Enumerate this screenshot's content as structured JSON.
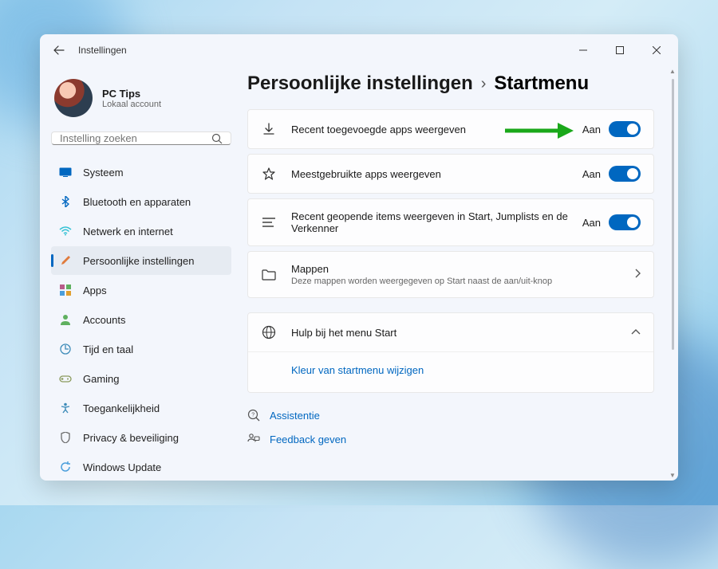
{
  "window": {
    "title": "Instellingen"
  },
  "profile": {
    "name": "PC Tips",
    "account_type": "Lokaal account"
  },
  "search": {
    "placeholder": "Instelling zoeken"
  },
  "sidebar": {
    "items": [
      {
        "id": "systeem",
        "label": "Systeem",
        "color": "#0067c0"
      },
      {
        "id": "bluetooth",
        "label": "Bluetooth en apparaten",
        "color": "#0067c0"
      },
      {
        "id": "netwerk",
        "label": "Netwerk en internet",
        "color": "#33c1d4"
      },
      {
        "id": "persoonlijk",
        "label": "Persoonlijke instellingen",
        "color": "#e07b3c",
        "active": true
      },
      {
        "id": "apps",
        "label": "Apps",
        "color": "#b85c8a"
      },
      {
        "id": "accounts",
        "label": "Accounts",
        "color": "#5fb05f"
      },
      {
        "id": "tijd",
        "label": "Tijd en taal",
        "color": "#3d8bb8"
      },
      {
        "id": "gaming",
        "label": "Gaming",
        "color": "#8a9a5b"
      },
      {
        "id": "toegankelijkheid",
        "label": "Toegankelijkheid",
        "color": "#3d8bb8"
      },
      {
        "id": "privacy",
        "label": "Privacy & beveiliging",
        "color": "#6b6b6b"
      },
      {
        "id": "update",
        "label": "Windows Update",
        "color": "#4a9edb"
      }
    ]
  },
  "breadcrumb": {
    "parent": "Persoonlijke instellingen",
    "current": "Startmenu"
  },
  "settings": [
    {
      "id": "recent-apps",
      "label": "Recent toegevoegde apps weergeven",
      "state_label": "Aan",
      "on": true,
      "highlight": true
    },
    {
      "id": "meest-gebruikt",
      "label": "Meestgebruikte apps weergeven",
      "state_label": "Aan",
      "on": true
    },
    {
      "id": "recent-items",
      "label": "Recent geopende items weergeven in Start, Jumplists en de Verkenner",
      "state_label": "Aan",
      "on": true
    }
  ],
  "folders": {
    "title": "Mappen",
    "subtitle": "Deze mappen worden weergegeven op Start naast de aan/uit-knop"
  },
  "help": {
    "title": "Hulp bij het menu Start",
    "link": "Kleur van startmenu wijzigen"
  },
  "footer": {
    "assist": "Assistentie",
    "feedback": "Feedback geven"
  },
  "colors": {
    "accent": "#0067c0",
    "highlight_arrow": "#1aa81a"
  }
}
